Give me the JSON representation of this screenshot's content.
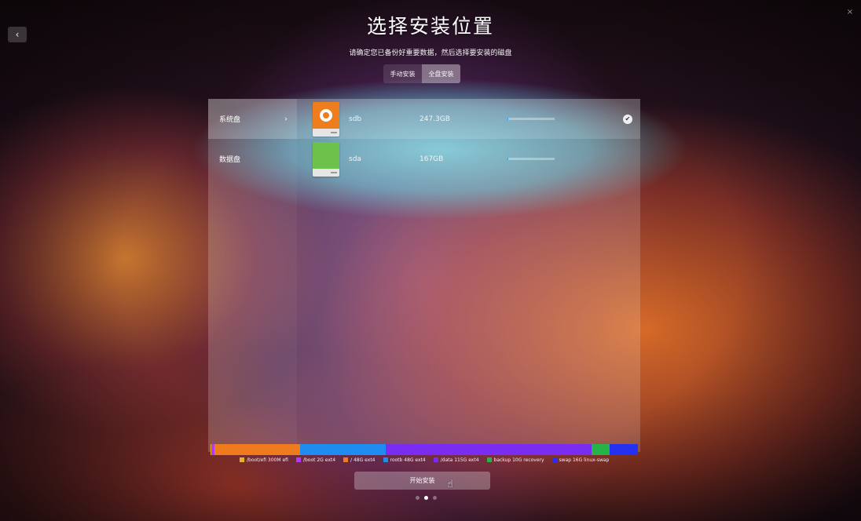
{
  "window": {
    "title": "选择安装位置",
    "subtitle": "请确定您已备份好重要数据，然后选择要安装的磁盘",
    "back_icon": "chevron-left-icon",
    "close_icon": "close-icon"
  },
  "tabs": [
    {
      "label": "手动安装",
      "active": false
    },
    {
      "label": "全盘安装",
      "active": true
    }
  ],
  "sidebar": {
    "items": [
      {
        "label": "系统盘",
        "active": true,
        "chevron": "›"
      },
      {
        "label": "数据盘",
        "active": false
      }
    ]
  },
  "disks": [
    {
      "name": "sdb",
      "size": "247.3GB",
      "usage": 0.02,
      "color": "#ee7d1e",
      "icon": "deepin-logo-icon",
      "selected": true
    },
    {
      "name": "sda",
      "size": "167GB",
      "usage": 0.02,
      "color": "#6cc24a",
      "icon": "disk-icon",
      "selected": false
    }
  ],
  "partitions": [
    {
      "label": "/boot/efi 300M efi",
      "size_gb": 0.3,
      "color": "#e6b325"
    },
    {
      "label": "/boot 2G ext4",
      "size_gb": 2,
      "color": "#b43cf0"
    },
    {
      "label": "/ 48G ext4",
      "size_gb": 48,
      "color": "#f07a1e"
    },
    {
      "label": "rootb 48G ext4",
      "size_gb": 48,
      "color": "#1e8cf0"
    },
    {
      "label": "/data 115G ext4",
      "size_gb": 115,
      "color": "#7a2cf0"
    },
    {
      "label": "backup 10G recovery",
      "size_gb": 10,
      "color": "#26b347"
    },
    {
      "label": "swap 16G linux-swap",
      "size_gb": 16,
      "color": "#2431f0"
    }
  ],
  "install_button": {
    "label": "开始安装"
  },
  "pager": {
    "count": 3,
    "active": 1
  }
}
